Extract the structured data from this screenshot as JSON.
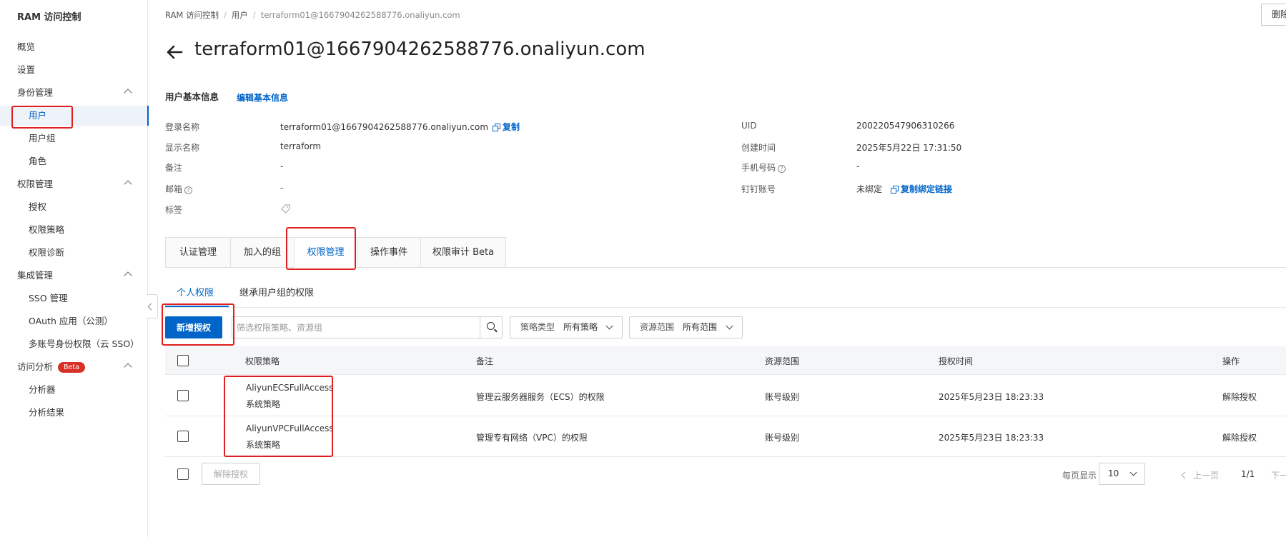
{
  "sidebar": {
    "title": "RAM 访问控制",
    "items": {
      "overview": "概览",
      "settings": "设置",
      "identity": "身份管理",
      "users": "用户",
      "groups": "用户组",
      "roles": "角色",
      "permissions": "权限管理",
      "grants": "授权",
      "policies": "权限策略",
      "diagnosis": "权限诊断",
      "integration": "集成管理",
      "sso": "SSO 管理",
      "oauth": "OAuth 应用（公测）",
      "multi_sso": "多账号身份权限（云 SSO）",
      "analysis": "访问分析",
      "analysis_badge": "Beta",
      "analyzer": "分析器",
      "results": "分析结果"
    }
  },
  "breadcrumb": [
    "RAM 访问控制",
    "用户",
    "terraform01@1667904262588776.onaliyun.com"
  ],
  "header": {
    "delete_label": "删除",
    "title": "terraform01@1667904262588776.onaliyun.com"
  },
  "basic_info": {
    "section_title": "用户基本信息",
    "edit_link": "编辑基本信息",
    "login_name_label": "登录名称",
    "login_name": "terraform01@1667904262588776.onaliyun.com",
    "copy_label": "复制",
    "display_name_label": "显示名称",
    "display_name": "terraform",
    "note_label": "备注",
    "note": "-",
    "email_label": "邮箱",
    "email": "-",
    "tags_label": "标签",
    "uid_label": "UID",
    "uid": "200220547906310266",
    "created_label": "创建时间",
    "created": "2025年5月22日 17:31:50",
    "phone_label": "手机号码",
    "phone": "-",
    "dingtalk_label": "钉钉账号",
    "dingtalk": "未绑定",
    "copy_bind_link": "复制绑定链接"
  },
  "tabs": [
    "认证管理",
    "加入的组",
    "权限管理",
    "操作事件",
    "权限审计 Beta"
  ],
  "subtabs": [
    "个人权限",
    "继承用户组的权限"
  ],
  "toolbar": {
    "add_grant": "新增授权",
    "search_placeholder": "筛选权限策略、资源组",
    "policy_type_label": "策略类型",
    "policy_type_value": "所有策略",
    "scope_label": "资源范围",
    "scope_value": "所有范围"
  },
  "table": {
    "headers": [
      "权限策略",
      "备注",
      "资源范围",
      "授权时间",
      "操作"
    ],
    "rows": [
      {
        "policy": "AliyunECSFullAccess",
        "type": "系统策略",
        "note": "管理云服务器服务（ECS）的权限",
        "scope": "账号级别",
        "time": "2025年5月23日 18:23:33",
        "action": "解除授权"
      },
      {
        "policy": "AliyunVPCFullAccess",
        "type": "系统策略",
        "note": "管理专有网络（VPC）的权限",
        "scope": "账号级别",
        "time": "2025年5月23日 18:23:33",
        "action": "解除授权"
      }
    ]
  },
  "footer": {
    "bulk_unauth": "解除授权",
    "page_size_label": "每页显示",
    "page_size": "10",
    "prev": "上一页",
    "page_indicator": "1/1",
    "next": "下一页"
  },
  "colors": {
    "primary": "#0064c8",
    "highlight_box": "#e02020",
    "beta_badge": "#d93026"
  }
}
